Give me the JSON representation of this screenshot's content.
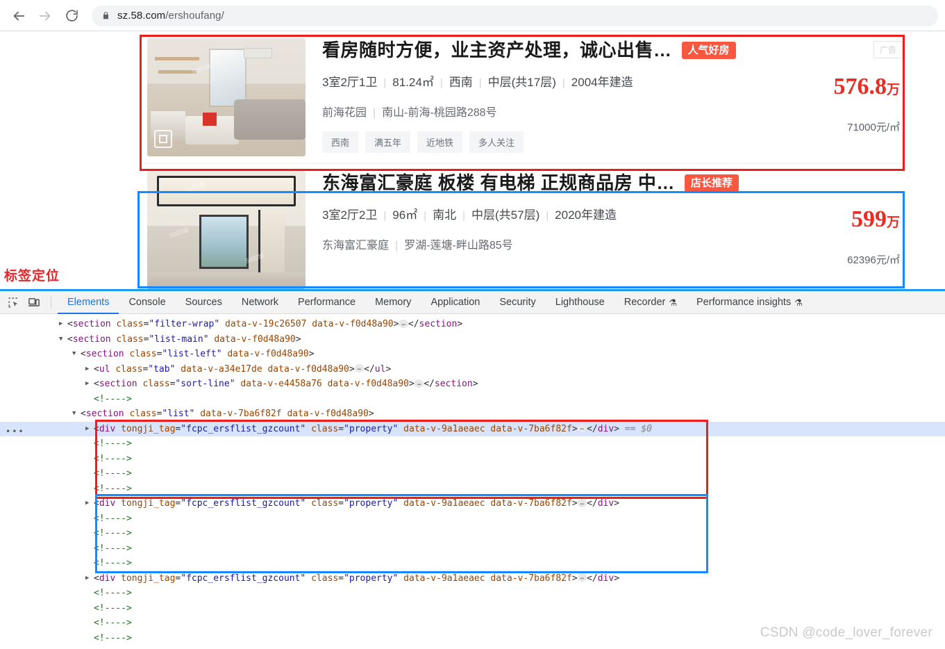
{
  "browser": {
    "back_icon": "arrow-left-icon",
    "forward_icon": "arrow-right-icon",
    "reload_icon": "reload-icon",
    "lock_icon": "lock-icon",
    "url_host": "sz.58.com",
    "url_path": "/ershoufang/",
    "url_full": "sz.58.com/ershoufang/"
  },
  "annotations": {
    "inspector_label": "标签定位",
    "label_color": "#e8262a",
    "circle_color": "#1faa4b",
    "ellipse_color": "#f0b400",
    "red_box_color": "#ef1c1c",
    "blue_box_color": "#1589ff"
  },
  "listings": [
    {
      "title": "看房随时方便，业主资产处理，诚心出售…",
      "badge": "人气好房",
      "ad_label": "广告",
      "layout": "3室2厅1卫",
      "area": "81.24㎡",
      "orientation": "西南",
      "floor": "中层(共17层)",
      "built": "2004年建造",
      "community": "前海花园",
      "address": "南山-前海-桃园路288号",
      "tags": [
        "西南",
        "满五年",
        "近地铁",
        "多人关注"
      ],
      "price_total": "576.8",
      "price_unit_char": "万",
      "price_per_sqm": "71000元/㎡",
      "vr_icon": "vr-photo-icon",
      "outline": "red"
    },
    {
      "title": "东海富汇豪庭 板楼 有电梯 正规商品房 中…",
      "badge": "店长推荐",
      "ad_label": "",
      "layout": "3室2厅2卫",
      "area": "96㎡",
      "orientation": "南北",
      "floor": "中层(共57层)",
      "built": "2020年建造",
      "community": "东海富汇豪庭",
      "address": "罗湖-莲塘-畔山路85号",
      "tags": [],
      "price_total": "599",
      "price_unit_char": "万",
      "price_per_sqm": "62396元/㎡",
      "vr_icon": "",
      "outline": "blue"
    }
  ],
  "devtools": {
    "inspect_icon": "inspect-element-icon",
    "device_icon": "device-toolbar-icon",
    "tabs": [
      {
        "label": "Elements",
        "active": true,
        "flask": false
      },
      {
        "label": "Console",
        "active": false,
        "flask": false
      },
      {
        "label": "Sources",
        "active": false,
        "flask": false
      },
      {
        "label": "Network",
        "active": false,
        "flask": false
      },
      {
        "label": "Performance",
        "active": false,
        "flask": false
      },
      {
        "label": "Memory",
        "active": false,
        "flask": false
      },
      {
        "label": "Application",
        "active": false,
        "flask": false
      },
      {
        "label": "Security",
        "active": false,
        "flask": false
      },
      {
        "label": "Lighthouse",
        "active": false,
        "flask": false
      },
      {
        "label": "Recorder",
        "active": false,
        "flask": true
      },
      {
        "label": "Performance insights",
        "active": false,
        "flask": true
      }
    ],
    "flask_glyph": "⚗",
    "dom_rows": [
      {
        "indent": 1,
        "tri": "closed",
        "sel": false,
        "box": "",
        "parts": [
          {
            "t": "p",
            "v": "<"
          },
          {
            "t": "tag",
            "v": "section"
          },
          {
            "t": "p",
            "v": " "
          },
          {
            "t": "attr",
            "v": "class"
          },
          {
            "t": "p",
            "v": "="
          },
          {
            "t": "val",
            "v": "\"filter-wrap\""
          },
          {
            "t": "p",
            "v": " "
          },
          {
            "t": "attr",
            "v": "data-v-19c26507"
          },
          {
            "t": "p",
            "v": " "
          },
          {
            "t": "attr",
            "v": "data-v-f0d48a90"
          },
          {
            "t": "p",
            "v": ">"
          },
          {
            "t": "dots",
            "v": "…"
          },
          {
            "t": "p",
            "v": "</"
          },
          {
            "t": "tag",
            "v": "section"
          },
          {
            "t": "p",
            "v": ">"
          }
        ]
      },
      {
        "indent": 1,
        "tri": "open",
        "sel": false,
        "box": "",
        "parts": [
          {
            "t": "p",
            "v": "<"
          },
          {
            "t": "tag",
            "v": "section"
          },
          {
            "t": "p",
            "v": " "
          },
          {
            "t": "attr",
            "v": "class"
          },
          {
            "t": "p",
            "v": "="
          },
          {
            "t": "val",
            "v": "\"list-main\""
          },
          {
            "t": "p",
            "v": " "
          },
          {
            "t": "attr",
            "v": "data-v-f0d48a90"
          },
          {
            "t": "p",
            "v": ">"
          }
        ]
      },
      {
        "indent": 2,
        "tri": "open",
        "sel": false,
        "box": "",
        "parts": [
          {
            "t": "p",
            "v": "<"
          },
          {
            "t": "tag",
            "v": "section"
          },
          {
            "t": "p",
            "v": " "
          },
          {
            "t": "attr",
            "v": "class"
          },
          {
            "t": "p",
            "v": "="
          },
          {
            "t": "val",
            "v": "\"list-left\""
          },
          {
            "t": "p",
            "v": " "
          },
          {
            "t": "attr",
            "v": "data-v-f0d48a90"
          },
          {
            "t": "p",
            "v": ">"
          }
        ]
      },
      {
        "indent": 3,
        "tri": "closed",
        "sel": false,
        "box": "",
        "parts": [
          {
            "t": "p",
            "v": "<"
          },
          {
            "t": "tag",
            "v": "ul"
          },
          {
            "t": "p",
            "v": " "
          },
          {
            "t": "attr",
            "v": "class"
          },
          {
            "t": "p",
            "v": "="
          },
          {
            "t": "val",
            "v": "\"tab\""
          },
          {
            "t": "p",
            "v": " "
          },
          {
            "t": "attr",
            "v": "data-v-a34e17de"
          },
          {
            "t": "p",
            "v": " "
          },
          {
            "t": "attr",
            "v": "data-v-f0d48a90"
          },
          {
            "t": "p",
            "v": ">"
          },
          {
            "t": "dots",
            "v": "…"
          },
          {
            "t": "p",
            "v": "</"
          },
          {
            "t": "tag",
            "v": "ul"
          },
          {
            "t": "p",
            "v": ">"
          }
        ]
      },
      {
        "indent": 3,
        "tri": "closed",
        "sel": false,
        "box": "",
        "parts": [
          {
            "t": "p",
            "v": "<"
          },
          {
            "t": "tag",
            "v": "section"
          },
          {
            "t": "p",
            "v": " "
          },
          {
            "t": "attr",
            "v": "class"
          },
          {
            "t": "p",
            "v": "="
          },
          {
            "t": "val",
            "v": "\"sort-line\""
          },
          {
            "t": "p",
            "v": " "
          },
          {
            "t": "attr",
            "v": "data-v-e4458a76"
          },
          {
            "t": "p",
            "v": " "
          },
          {
            "t": "attr",
            "v": "data-v-f0d48a90"
          },
          {
            "t": "p",
            "v": ">"
          },
          {
            "t": "dots",
            "v": "…"
          },
          {
            "t": "p",
            "v": "</"
          },
          {
            "t": "tag",
            "v": "section"
          },
          {
            "t": "p",
            "v": ">"
          }
        ]
      },
      {
        "indent": 3,
        "tri": "none",
        "sel": false,
        "box": "",
        "parts": [
          {
            "t": "cm",
            "v": "<!---->"
          }
        ]
      },
      {
        "indent": 2,
        "tri": "open",
        "sel": false,
        "box": "",
        "parts": [
          {
            "t": "p",
            "v": "<"
          },
          {
            "t": "tag",
            "v": "section"
          },
          {
            "t": "p",
            "v": " "
          },
          {
            "t": "attr",
            "v": "class"
          },
          {
            "t": "p",
            "v": "="
          },
          {
            "t": "val",
            "v": "\"list\""
          },
          {
            "t": "p",
            "v": " "
          },
          {
            "t": "attr",
            "v": "data-v-7ba6f82f"
          },
          {
            "t": "p",
            "v": " "
          },
          {
            "t": "attr",
            "v": "data-v-f0d48a90"
          },
          {
            "t": "p",
            "v": ">"
          }
        ]
      },
      {
        "indent": 3,
        "tri": "closed",
        "sel": true,
        "box": "red-top",
        "parts": [
          {
            "t": "p",
            "v": "<"
          },
          {
            "t": "tag",
            "v": "div"
          },
          {
            "t": "p",
            "v": " "
          },
          {
            "t": "attr",
            "v": "tongji_tag"
          },
          {
            "t": "p",
            "v": "="
          },
          {
            "t": "val",
            "v": "\"fcpc_ersflist_gzcount\""
          },
          {
            "t": "p",
            "v": " "
          },
          {
            "t": "attr",
            "v": "class"
          },
          {
            "t": "p",
            "v": "="
          },
          {
            "t": "val",
            "v": "\"property\""
          },
          {
            "t": "p",
            "v": " "
          },
          {
            "t": "attr",
            "v": "data-v-9a1aeaec"
          },
          {
            "t": "p",
            "v": " "
          },
          {
            "t": "attr",
            "v": "data-v-7ba6f82f"
          },
          {
            "t": "p",
            "v": ">"
          },
          {
            "t": "dots",
            "v": "…"
          },
          {
            "t": "p",
            "v": "</"
          },
          {
            "t": "tag",
            "v": "div"
          },
          {
            "t": "p",
            "v": ">"
          },
          {
            "t": "eq",
            "v": " == "
          },
          {
            "t": "eqv",
            "v": "$0"
          }
        ]
      },
      {
        "indent": 3,
        "tri": "none",
        "sel": false,
        "box": "red-mid",
        "parts": [
          {
            "t": "cm",
            "v": "<!---->"
          }
        ]
      },
      {
        "indent": 3,
        "tri": "none",
        "sel": false,
        "box": "red-mid",
        "parts": [
          {
            "t": "cm",
            "v": "<!---->"
          }
        ]
      },
      {
        "indent": 3,
        "tri": "none",
        "sel": false,
        "box": "red-mid",
        "parts": [
          {
            "t": "cm",
            "v": "<!---->"
          }
        ]
      },
      {
        "indent": 3,
        "tri": "none",
        "sel": false,
        "box": "red-bot",
        "parts": [
          {
            "t": "cm",
            "v": "<!---->"
          }
        ]
      },
      {
        "indent": 3,
        "tri": "closed",
        "sel": false,
        "box": "blue-top",
        "parts": [
          {
            "t": "p",
            "v": "<"
          },
          {
            "t": "tag",
            "v": "div"
          },
          {
            "t": "p",
            "v": " "
          },
          {
            "t": "attr",
            "v": "tongji_tag"
          },
          {
            "t": "p",
            "v": "="
          },
          {
            "t": "val",
            "v": "\"fcpc_ersflist_gzcount\""
          },
          {
            "t": "p",
            "v": " "
          },
          {
            "t": "attr",
            "v": "class"
          },
          {
            "t": "p",
            "v": "="
          },
          {
            "t": "val",
            "v": "\"property\""
          },
          {
            "t": "p",
            "v": " "
          },
          {
            "t": "attr",
            "v": "data-v-9a1aeaec"
          },
          {
            "t": "p",
            "v": " "
          },
          {
            "t": "attr",
            "v": "data-v-7ba6f82f"
          },
          {
            "t": "p",
            "v": ">"
          },
          {
            "t": "dots",
            "v": "…"
          },
          {
            "t": "p",
            "v": "</"
          },
          {
            "t": "tag",
            "v": "div"
          },
          {
            "t": "p",
            "v": ">"
          }
        ]
      },
      {
        "indent": 3,
        "tri": "none",
        "sel": false,
        "box": "blue-mid",
        "parts": [
          {
            "t": "cm",
            "v": "<!---->"
          }
        ]
      },
      {
        "indent": 3,
        "tri": "none",
        "sel": false,
        "box": "blue-mid",
        "parts": [
          {
            "t": "cm",
            "v": "<!---->"
          }
        ]
      },
      {
        "indent": 3,
        "tri": "none",
        "sel": false,
        "box": "blue-mid",
        "parts": [
          {
            "t": "cm",
            "v": "<!---->"
          }
        ]
      },
      {
        "indent": 3,
        "tri": "none",
        "sel": false,
        "box": "blue-bot",
        "parts": [
          {
            "t": "cm",
            "v": "<!---->"
          }
        ]
      },
      {
        "indent": 3,
        "tri": "closed",
        "sel": false,
        "box": "",
        "parts": [
          {
            "t": "p",
            "v": "<"
          },
          {
            "t": "tag",
            "v": "div"
          },
          {
            "t": "p",
            "v": " "
          },
          {
            "t": "attr",
            "v": "tongji_tag"
          },
          {
            "t": "p",
            "v": "="
          },
          {
            "t": "val",
            "v": "\"fcpc_ersflist_gzcount\""
          },
          {
            "t": "p",
            "v": " "
          },
          {
            "t": "attr",
            "v": "class"
          },
          {
            "t": "p",
            "v": "="
          },
          {
            "t": "val",
            "v": "\"property\""
          },
          {
            "t": "p",
            "v": " "
          },
          {
            "t": "attr",
            "v": "data-v-9a1aeaec"
          },
          {
            "t": "p",
            "v": " "
          },
          {
            "t": "attr",
            "v": "data-v-7ba6f82f"
          },
          {
            "t": "p",
            "v": ">"
          },
          {
            "t": "dots",
            "v": "…"
          },
          {
            "t": "p",
            "v": "</"
          },
          {
            "t": "tag",
            "v": "div"
          },
          {
            "t": "p",
            "v": ">"
          }
        ]
      },
      {
        "indent": 3,
        "tri": "none",
        "sel": false,
        "box": "",
        "parts": [
          {
            "t": "cm",
            "v": "<!---->"
          }
        ]
      },
      {
        "indent": 3,
        "tri": "none",
        "sel": false,
        "box": "",
        "parts": [
          {
            "t": "cm",
            "v": "<!---->"
          }
        ]
      },
      {
        "indent": 3,
        "tri": "none",
        "sel": false,
        "box": "",
        "parts": [
          {
            "t": "cm",
            "v": "<!---->"
          }
        ]
      },
      {
        "indent": 3,
        "tri": "none",
        "sel": false,
        "box": "",
        "parts": [
          {
            "t": "cm",
            "v": "<!---->"
          }
        ]
      }
    ]
  },
  "watermark": "CSDN @code_lover_forever"
}
